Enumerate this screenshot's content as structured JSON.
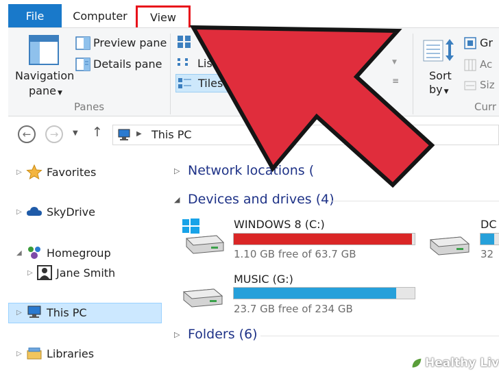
{
  "ribbon_tabs": {
    "file": "File",
    "computer": "Computer",
    "view": "View"
  },
  "panes_group": {
    "navigation_pane_line1": "Navigation",
    "navigation_pane_line2": "pane",
    "preview_pane": "Preview pane",
    "details_pane": "Details pane",
    "group_label": "Panes"
  },
  "layout_group": {
    "list": "List",
    "tiles": "Tiles"
  },
  "current_view_group": {
    "sort_by_line1": "Sort",
    "sort_by_line2": "by",
    "group_partial": "Gr",
    "add_partial": "Ac",
    "size_partial": "Siz",
    "group_label_partial": "Curr"
  },
  "address_bar": {
    "path": "This PC"
  },
  "nav_pane": {
    "favorites": "Favorites",
    "skydrive": "SkyDrive",
    "homegroup": "Homegroup",
    "jane_smith": "Jane Smith",
    "this_pc": "This PC",
    "libraries": "Libraries"
  },
  "content": {
    "network_locations": "Network locations (",
    "devices_and_drives": "Devices and drives (4)",
    "folders": "Folders (6)",
    "drives": [
      {
        "name": "WINDOWS 8 (C:)",
        "free": "1.10 GB free of 63.7 GB",
        "used_fraction": 0.983,
        "bar_color": "#da2626"
      },
      {
        "name": "MUSIC (G:)",
        "free": "23.7 GB free of 234 GB",
        "used_fraction": 0.899,
        "bar_color": "#26a0da"
      },
      {
        "name": "DC",
        "free": "32",
        "used_fraction": 0.5,
        "bar_color": "#26a0da"
      }
    ]
  },
  "watermark": "Healthy Living",
  "colors": {
    "arrow_red": "#e02d3c",
    "file_tab_blue": "#1979ca",
    "view_highlight": "#e8101a"
  }
}
